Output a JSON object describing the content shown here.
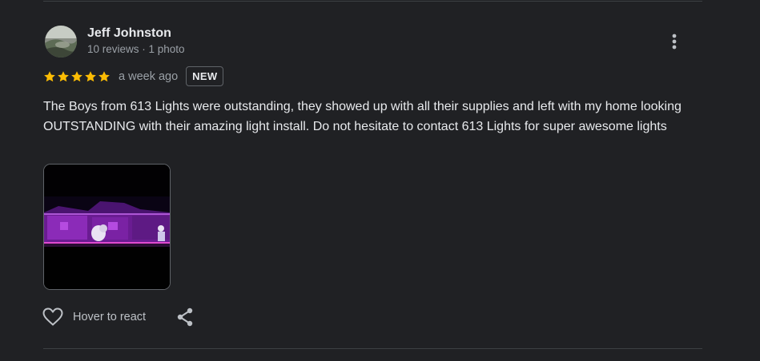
{
  "review": {
    "reviewer_name": "Jeff Johnston",
    "reviewer_meta": "10 reviews · 1 photo",
    "rating": 5,
    "rating_max": 5,
    "date": "a week ago",
    "badge": "NEW",
    "text": "The Boys from 613 Lights were outstanding, they showed up with all their supplies and left with my home looking OUTSTANDING with their amazing light install. Do not hesitate to contact 613 Lights for super awesome lights",
    "photo_count": 1
  },
  "actions": {
    "react_label": "Hover to react",
    "react_icon": "heart-outline-icon",
    "share_icon": "share-icon",
    "more_icon": "more-vertical-icon"
  },
  "colors": {
    "background": "#202124",
    "text_primary": "#e8eaed",
    "text_secondary": "#9aa0a6",
    "star": "#fbbc04",
    "divider": "#3c4043"
  }
}
